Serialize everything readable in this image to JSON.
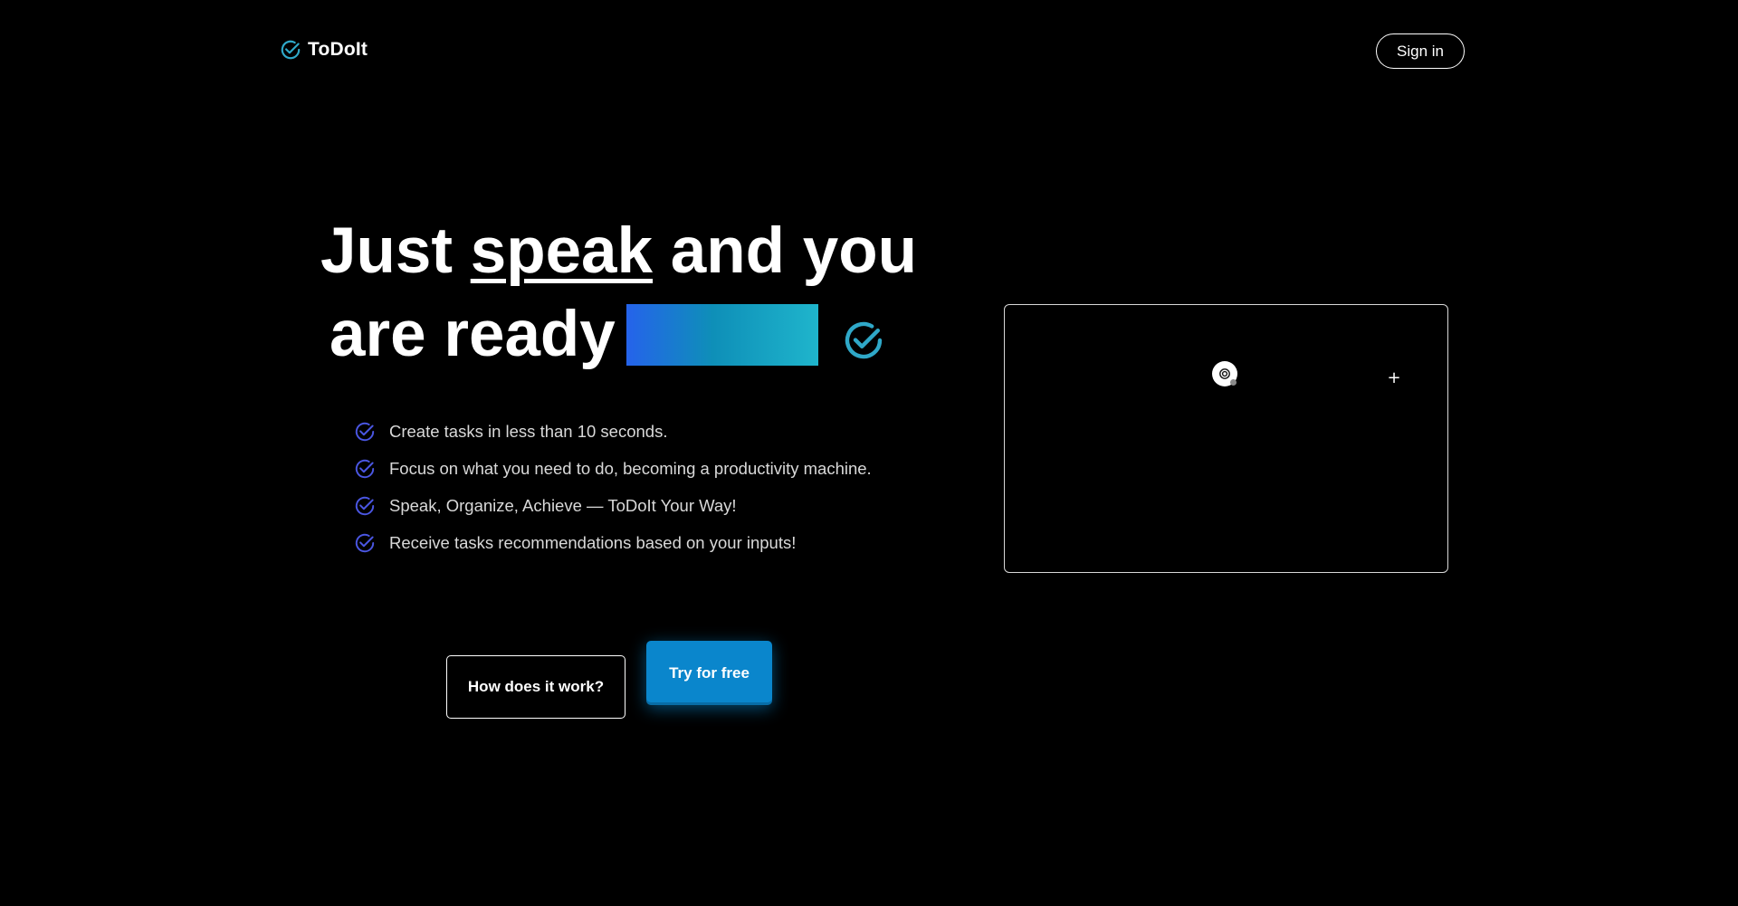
{
  "header": {
    "logo_text": "ToDoIt",
    "logo_icon": "check-circle-icon",
    "signin_label": "Sign in"
  },
  "hero": {
    "headline_part1": "Just ",
    "headline_emphasis": "speak",
    "headline_part2": " and you",
    "headline_line2": "are ready",
    "gradient_colors": [
      "#2563eb",
      "#0e8fb8",
      "#1fb5cc"
    ],
    "check_icon": "check-circle-icon",
    "check_color": "#2fa8c8"
  },
  "features": [
    {
      "icon": "check-circle-icon",
      "text": "Create tasks in less than 10 seconds."
    },
    {
      "icon": "check-circle-icon",
      "text": "Focus on what you need to do, becoming a productivity machine."
    },
    {
      "icon": "check-circle-icon",
      "text": "Speak, Organize, Achieve — ToDoIt Your Way!"
    },
    {
      "icon": "check-circle-icon",
      "text": "Receive tasks recommendations based on your inputs!"
    }
  ],
  "feature_icon_color": "#4a56e2",
  "actions": {
    "how_label": "How does it work?",
    "try_label": "Try for free",
    "try_color": "#0a86cc"
  },
  "demo": {
    "mic_icon": "microphone-icon",
    "add_label": "+"
  }
}
